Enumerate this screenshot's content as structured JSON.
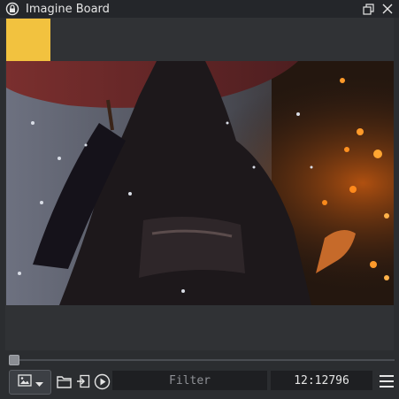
{
  "window": {
    "title": "Imagine Board",
    "app_icon": "shield-lock-icon",
    "buttons": [
      "restore-icon",
      "close-icon"
    ]
  },
  "toolbar": {
    "viewer_icon": "image-icon",
    "dropdown_icon": "chevron-down-icon",
    "folder_icon": "folder-icon",
    "import_icon": "import-icon",
    "play_icon": "play-icon",
    "filter_placeholder": "Filter",
    "counter": "12:12796",
    "menu_icon": "hamburger-menu-icon"
  },
  "thumbnail": {
    "color": "#f2c23f"
  },
  "slider": {
    "position": 0
  },
  "colors": {
    "accent": "#f2c23f",
    "background": "#2b2d30",
    "ember": "#ff8a1c"
  }
}
